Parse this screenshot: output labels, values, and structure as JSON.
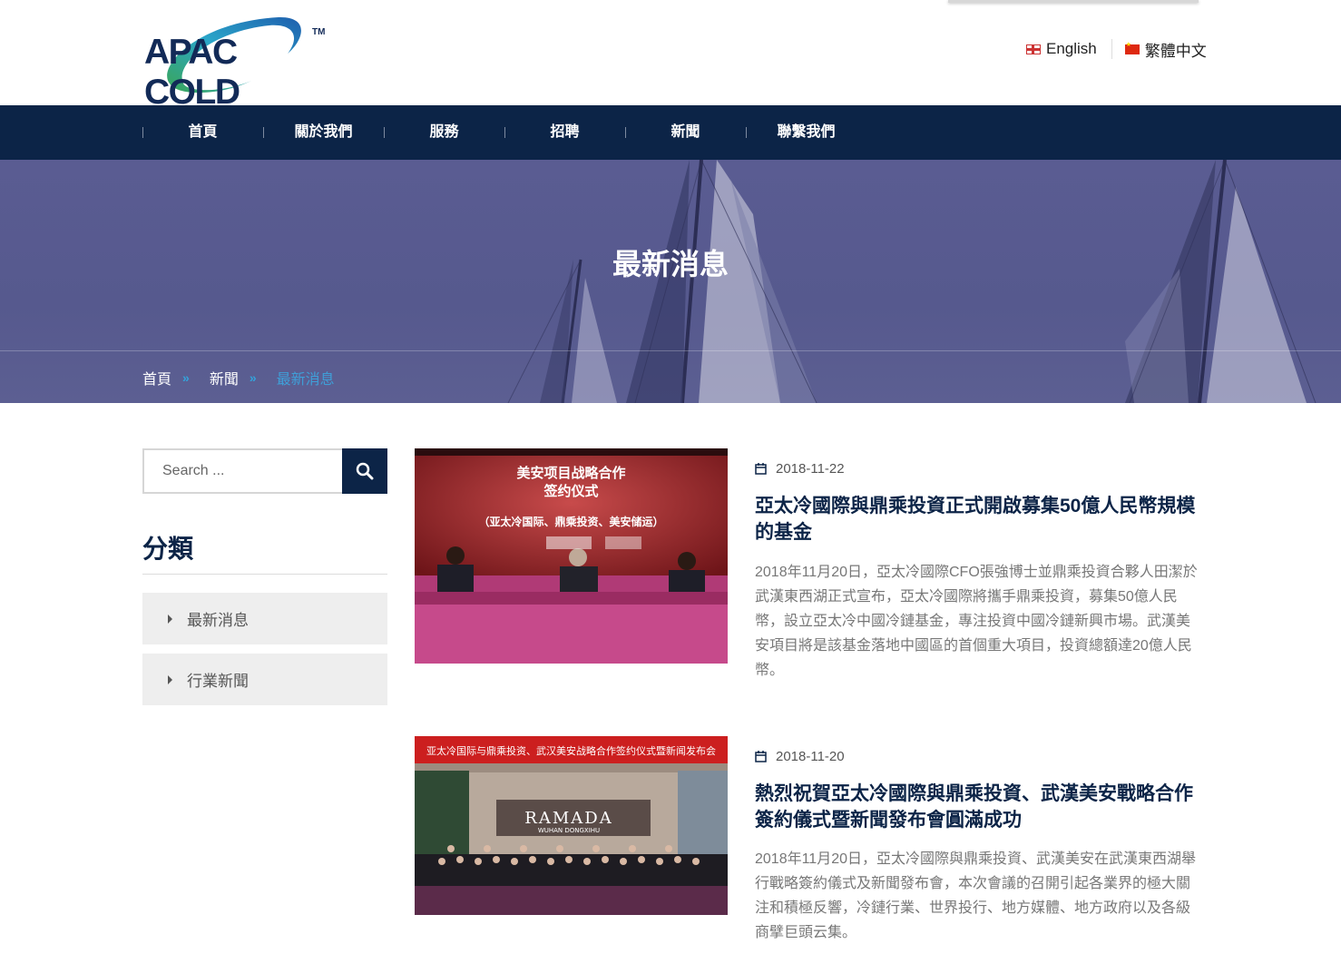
{
  "header": {
    "logo_text": "APAC COLD",
    "logo_tm": "TM",
    "languages": [
      {
        "label": "English",
        "flag": "uk-flag-icon"
      },
      {
        "label": "繁體中文",
        "flag": "china-flag-icon"
      }
    ]
  },
  "nav": {
    "items": [
      {
        "label": "首頁"
      },
      {
        "label": "關於我們"
      },
      {
        "label": "服務"
      },
      {
        "label": "招聘"
      },
      {
        "label": "新聞"
      },
      {
        "label": "聯繫我們"
      }
    ]
  },
  "hero": {
    "title": "最新消息",
    "breadcrumb": [
      "首頁",
      "新聞",
      "最新消息"
    ]
  },
  "sidebar": {
    "search_placeholder": "Search ...",
    "categories_title": "分類",
    "categories": [
      "最新消息",
      "行業新聞"
    ]
  },
  "posts": [
    {
      "date": "2018-11-22",
      "title": "亞太冷國際與鼎乘投資正式開啟募集50億人民幣規模的基金",
      "excerpt": "2018年11月20日，亞太冷國際CFO張強博士並鼎乘投資合夥人田潔於武漢東西湖正式宣布，亞太冷國際將攜手鼎乘投資，募集50億人民幣，設立亞太冷中國冷鏈基金，專注投資中國冷鏈新興市場。武漢美安項目將是該基金落地中國區的首個重大項目，投資總額達20億人民幣。",
      "image_banner_line1": "美安项目战略合作",
      "image_banner_line2": "签约仪式",
      "image_banner_line3": "（亚太冷国际、鼎乘投资、美安储运）"
    },
    {
      "date": "2018-11-20",
      "title": "熱烈祝賀亞太冷國際與鼎乘投資、武漢美安戰略合作簽約儀式暨新聞發布會圓滿成功",
      "excerpt": "2018年11月20日，亞太冷國際與鼎乘投資、武漢美安在武漢東西湖舉行戰略簽約儀式及新聞發布會，本次會議的召開引起各業界的極大關注和積極反響，冷鏈行業、世界投行、地方媒體、地方政府以及各級商擘巨頭云集。",
      "image_banner": "亚太冷国际与鼎乘投资、武汉美安战略合作签约仪式暨新闻发布会",
      "image_sign": "RAMADA",
      "image_sign_sub": "WUHAN DONGXIHU"
    }
  ],
  "colors": {
    "navy": "#0c2447",
    "accent_blue": "#3f9fd8"
  }
}
